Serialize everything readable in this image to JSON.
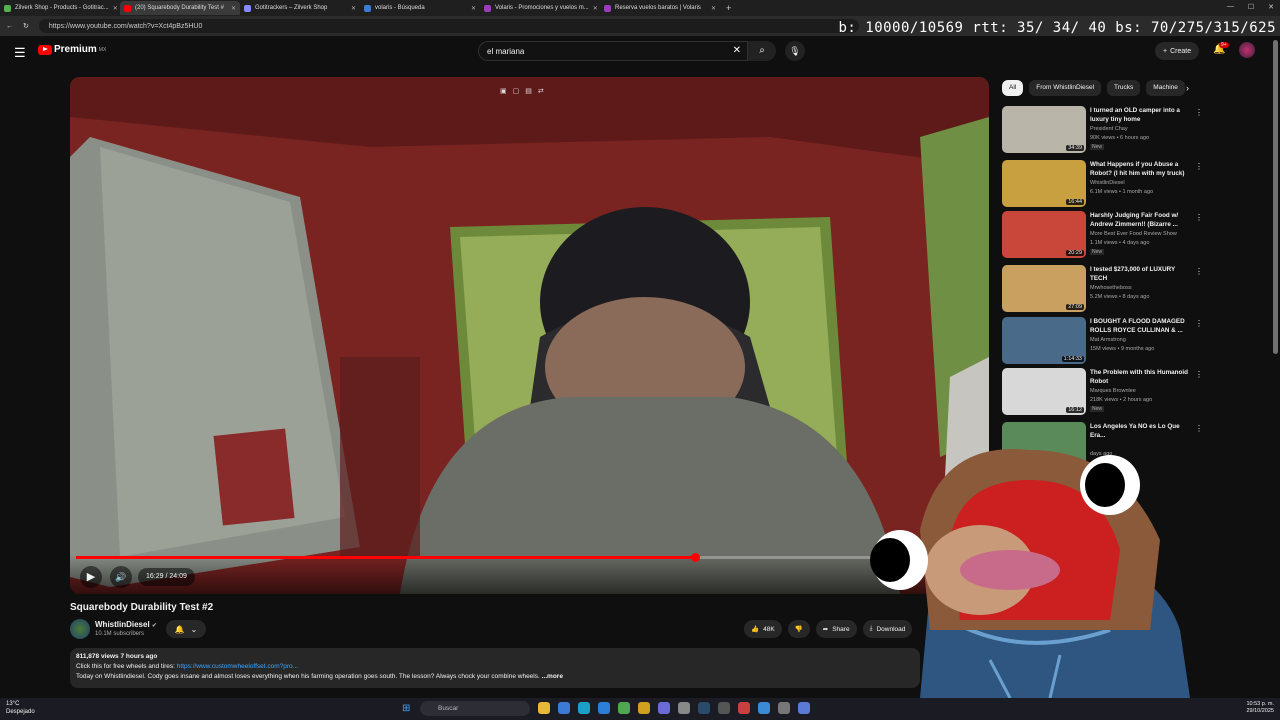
{
  "browser": {
    "tabs": [
      {
        "title": "Zilverk Shop - Products - Gotitrac...",
        "color": "#4fb34f"
      },
      {
        "title": "(20) Squarebody Durability Test #",
        "color": "#ff0000"
      },
      {
        "title": "Gotitrackers – Zilverk Shop",
        "color": "#8888ff"
      },
      {
        "title": "volaris - Búsqueda",
        "color": "#3b7bd6"
      },
      {
        "title": "Volaris - Promociones y vuelos m...",
        "color": "#9b3bbf"
      },
      {
        "title": "Reserva vuelos baratos | Volaris",
        "color": "#9b3bbf"
      }
    ],
    "url": "https://www.youtube.com/watch?v=Xct4pBz5HU0",
    "stats_overlay": "b: 10000/10569 rtt:  35/ 34/ 40 bs:  70/275/315/625"
  },
  "header": {
    "logo_text": "Premium",
    "logo_region": "MX",
    "search_value": "el mariana",
    "create_label": "Create",
    "notif_count": "9+"
  },
  "player": {
    "current_time": "16:29 / 24:09",
    "progress": 0.682
  },
  "video": {
    "title": "Squarebody Durability Test #2",
    "channel": "WhistlinDiesel",
    "subscribers": "10.1M subscribers",
    "likes": "48K",
    "share_label": "Share",
    "download_label": "Download",
    "desc_meta": "811,878 views  7 hours ago",
    "desc_line1_prefix": "Click this for free wheels and tires: ",
    "desc_link": "https://www.customwheeloffset.com?pro...",
    "desc_line2": "Today on Whistlindiesel. Cody goes insane and almost loses everything when his farming operation goes south. The lesson? Always chock your combine wheels.",
    "desc_more": "...more"
  },
  "chips": [
    "All",
    "From WhistlinDiesel",
    "Trucks",
    "Machine"
  ],
  "recommendations": [
    {
      "title": "I turned an OLD camper into a luxury tiny home",
      "channel": "President Chay",
      "views": "90K views • 6 hours ago",
      "badge": "New",
      "duration": "34:39",
      "color": "#b9b5a8"
    },
    {
      "title": "What Happens if you Abuse a Robot? (I hit him with my truck)",
      "channel": "WhistlinDiesel",
      "views": "6.1M views • 1 month ago",
      "badge": "",
      "duration": "16:44",
      "color": "#c8a040"
    },
    {
      "title": "Harshly Judging Fair Food w/ Andrew Zimmern!! (Bizarre ...",
      "channel": "More Best Ever Food Review Show",
      "views": "1.1M views • 4 days ago",
      "badge": "New",
      "duration": "20:29",
      "color": "#c8463a"
    },
    {
      "title": "I tested $273,000 of LUXURY TECH",
      "channel": "Mrwhosetheboss",
      "views": "5.2M views • 8 days ago",
      "badge": "",
      "duration": "27:09",
      "color": "#caa060"
    },
    {
      "title": "I BOUGHT A FLOOD DAMAGED ROLLS ROYCE CULLINAN & ...",
      "channel": "Mat Armstrong",
      "views": "15M views • 9 months ago",
      "badge": "",
      "duration": "1:14:33",
      "color": "#4a6a8a"
    },
    {
      "title": "The Problem with this Humanoid Robot",
      "channel": "Marques Brownlee",
      "views": "218K views • 2 hours ago",
      "badge": "New",
      "duration": "16:12",
      "color": "#d8d8d8"
    },
    {
      "title": "Los Angeles Ya NO es Lo Que Era...",
      "channel": "",
      "views": "days ago",
      "badge": "",
      "duration": "",
      "color": "#5a8a5a"
    }
  ],
  "taskbar": {
    "temp": "13°C",
    "weather": "Despejado",
    "search_label": "Buscar",
    "time": "10:53 p. m.",
    "date": "29/10/2025"
  }
}
